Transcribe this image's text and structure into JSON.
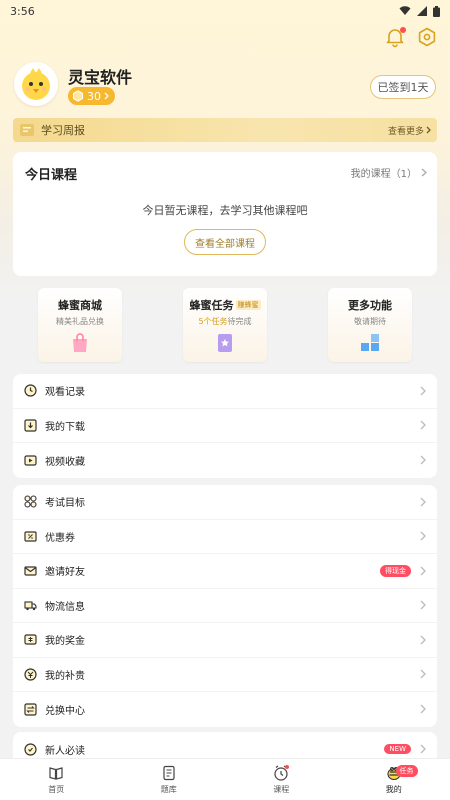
{
  "status_bar": {
    "time": "3:56"
  },
  "profile": {
    "username": "灵宝软件",
    "coins": "30",
    "signin_label": "已签到1天"
  },
  "report": {
    "title": "学习周报",
    "more": "查看更多"
  },
  "today_course": {
    "title": "今日课程",
    "my_courses": "我的课程（1）",
    "empty_text": "今日暂无课程，去学习其他课程吧",
    "view_all": "查看全部课程"
  },
  "features": [
    {
      "title": "蜂蜜商城",
      "subtitle": "精美礼品兑换",
      "icon": "shopping-bag-icon"
    },
    {
      "title": "蜂蜜任务",
      "tag": "赚蜂蜜",
      "subtitle_highlight": "5个任务",
      "subtitle_rest": "待完成",
      "icon": "task-book-icon"
    },
    {
      "title": "更多功能",
      "subtitle": "敬请期待",
      "icon": "blocks-icon"
    }
  ],
  "list_group_1": [
    {
      "label": "观看记录",
      "icon": "history-icon"
    },
    {
      "label": "我的下载",
      "icon": "download-icon"
    },
    {
      "label": "视频收藏",
      "icon": "video-collect-icon"
    }
  ],
  "list_group_2": [
    {
      "label": "考试目标",
      "icon": "target-icon"
    },
    {
      "label": "优惠券",
      "icon": "coupon-icon"
    },
    {
      "label": "邀请好友",
      "icon": "invite-icon",
      "badge": "得现金"
    },
    {
      "label": "物流信息",
      "icon": "truck-icon"
    },
    {
      "label": "我的奖金",
      "icon": "bonus-icon"
    },
    {
      "label": "我的补贵",
      "icon": "subsidy-icon"
    },
    {
      "label": "兑换中心",
      "icon": "exchange-icon"
    }
  ],
  "list_group_3": [
    {
      "label": "新人必读",
      "icon": "newbie-icon",
      "badge": "NEW"
    }
  ],
  "tabbar": {
    "home": "首页",
    "question_bank": "题库",
    "courses": "课程",
    "mine": "我的",
    "task_badge": "任务"
  },
  "colors": {
    "accent": "#f5b82e",
    "badge_red": "#ff4d62",
    "report_bar": "#f4d98e"
  }
}
